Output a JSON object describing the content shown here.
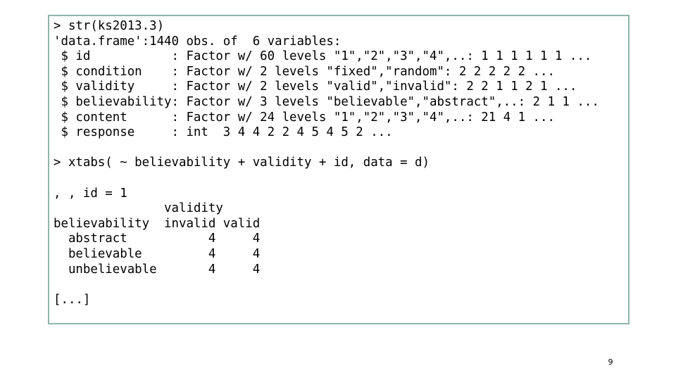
{
  "slide": {
    "page_number": "9",
    "border_color": "#8fb4ac",
    "background_color": "#ffffff",
    "text_color": "#000000"
  },
  "console": {
    "lines": [
      "> str(ks2013.3)",
      "'data.frame':1440 obs. of  6 variables:",
      " $ id           : Factor w/ 60 levels \"1\",\"2\",\"3\",\"4\",..: 1 1 1 1 1 1 ...",
      " $ condition    : Factor w/ 2 levels \"fixed\",\"random\": 2 2 2 2 2 ...",
      " $ validity     : Factor w/ 2 levels \"valid\",\"invalid\": 2 2 1 1 2 1 ...",
      " $ believability: Factor w/ 3 levels \"believable\",\"abstract\",..: 2 1 1 ...",
      " $ content      : Factor w/ 24 levels \"1\",\"2\",\"3\",\"4\",..: 21 4 1 ...",
      " $ response     : int  3 4 4 2 2 4 5 4 5 2 ...",
      "",
      "> xtabs( ~ believability + validity + id, data = d)",
      "",
      ", , id = 1",
      "               validity",
      "believability  invalid valid",
      "  abstract           4     4",
      "  believable         4     4",
      "  unbelievable       4     4",
      "",
      "[...]"
    ],
    "full_text": "> str(ks2013.3)\n'data.frame':1440 obs. of  6 variables:\n $ id           : Factor w/ 60 levels \"1\",\"2\",\"3\",\"4\",..: 1 1 1 1 1 1 ...\n $ condition    : Factor w/ 2 levels \"fixed\",\"random\": 2 2 2 2 2 ...\n $ validity     : Factor w/ 2 levels \"valid\",\"invalid\": 2 2 1 1 2 1 ...\n $ believability: Factor w/ 3 levels \"believable\",\"abstract\",..: 2 1 1 ...\n $ content      : Factor w/ 24 levels \"1\",\"2\",\"3\",\"4\",..: 21 4 1 ...\n $ response     : int  3 4 4 2 2 4 5 4 5 2 ...\n\n> xtabs( ~ believability + validity + id, data = d)\n\n, , id = 1\n               validity\nbelievability  invalid valid\n  abstract           4     4\n  believable         4     4\n  unbelievable       4     4\n\n[...]",
    "commands": [
      "str(ks2013.3)",
      "xtabs( ~ believability + validity + id, data = d)"
    ],
    "dataframe": {
      "header": "'data.frame':1440 obs. of  6 variables:",
      "n_obs": "1440",
      "n_variables": "6",
      "variables": [
        {
          "name": "id",
          "type": "Factor",
          "levels_count": "60",
          "levels": "\"1\",\"2\",\"3\",\"4\",..",
          "values": "1 1 1 1 1 1 ..."
        },
        {
          "name": "condition",
          "type": "Factor",
          "levels_count": "2",
          "levels": "\"fixed\",\"random\"",
          "values": "2 2 2 2 2 ..."
        },
        {
          "name": "validity",
          "type": "Factor",
          "levels_count": "2",
          "levels": "\"valid\",\"invalid\"",
          "values": "2 2 1 1 2 1 ..."
        },
        {
          "name": "believability",
          "type": "Factor",
          "levels_count": "3",
          "levels": "\"believable\",\"abstract\",..",
          "values": "2 1 1 ..."
        },
        {
          "name": "content",
          "type": "Factor",
          "levels_count": "24",
          "levels": "\"1\",\"2\",\"3\",\"4\",..",
          "values": "21 4 1 ..."
        },
        {
          "name": "response",
          "type": "int",
          "levels_count": "",
          "levels": "",
          "values": "3 4 4 2 2 4 5 4 5 2 ..."
        }
      ]
    },
    "xtabs_table": {
      "stratum_label": ", , id = 1",
      "column_group_label": "validity",
      "row_group_label": "believability",
      "column_headers": [
        "invalid",
        "valid"
      ],
      "rows": [
        {
          "label": "abstract",
          "values": [
            "4",
            "4"
          ]
        },
        {
          "label": "believable",
          "values": [
            "4",
            "4"
          ]
        },
        {
          "label": "unbelievable",
          "values": [
            "4",
            "4"
          ]
        }
      ]
    },
    "truncation_marker": "[...]"
  }
}
